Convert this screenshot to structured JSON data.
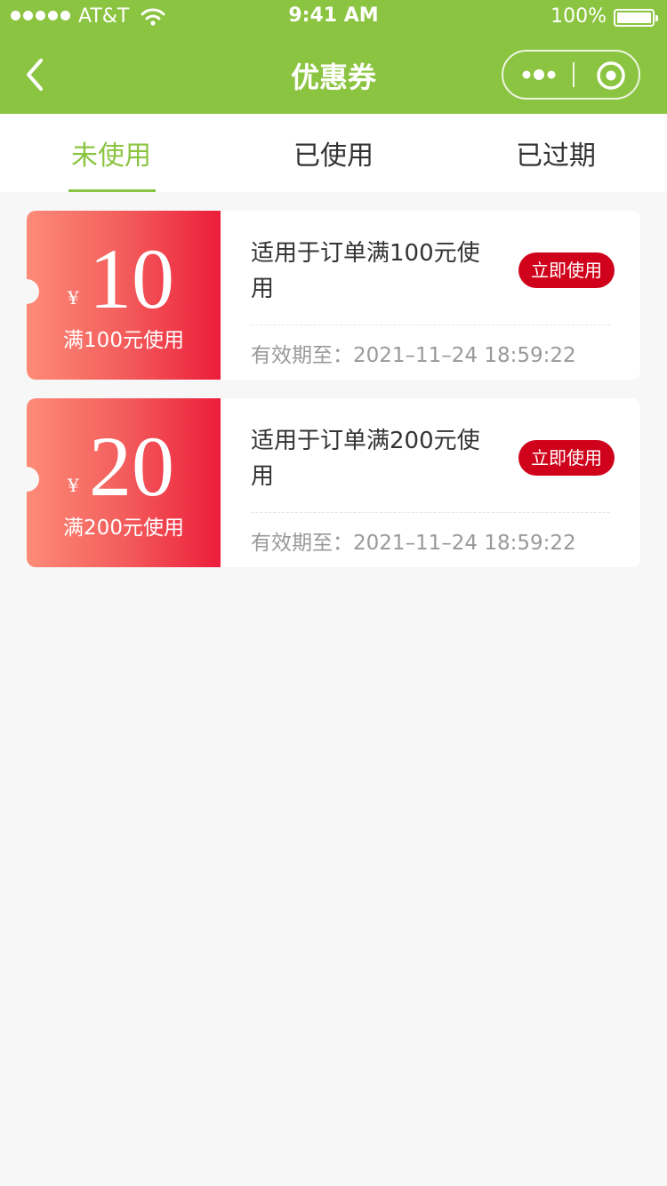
{
  "status_bar": {
    "carrier": "AT&T",
    "time": "9:41 AM",
    "battery": "100%"
  },
  "nav": {
    "title": "优惠券"
  },
  "tabs": [
    {
      "label": "未使用"
    },
    {
      "label": "已使用"
    },
    {
      "label": "已过期"
    }
  ],
  "coupons": [
    {
      "currency": "¥",
      "amount": "10",
      "min_spend": "满100元使用",
      "description": "适用于订单满100元使用",
      "action": "立即使用",
      "expiry": "有效期至：2021–11–24 18:59:22"
    },
    {
      "currency": "¥",
      "amount": "20",
      "min_spend": "满200元使用",
      "description": "适用于订单满200元使用",
      "action": "立即使用",
      "expiry": "有效期至：2021–11–24 18:59:22"
    }
  ],
  "colors": {
    "brand_green": "#8bc441",
    "coupon_gradient_start": "#fd8b78",
    "coupon_gradient_end": "#ec1d3b",
    "action_red": "#d0021b"
  }
}
